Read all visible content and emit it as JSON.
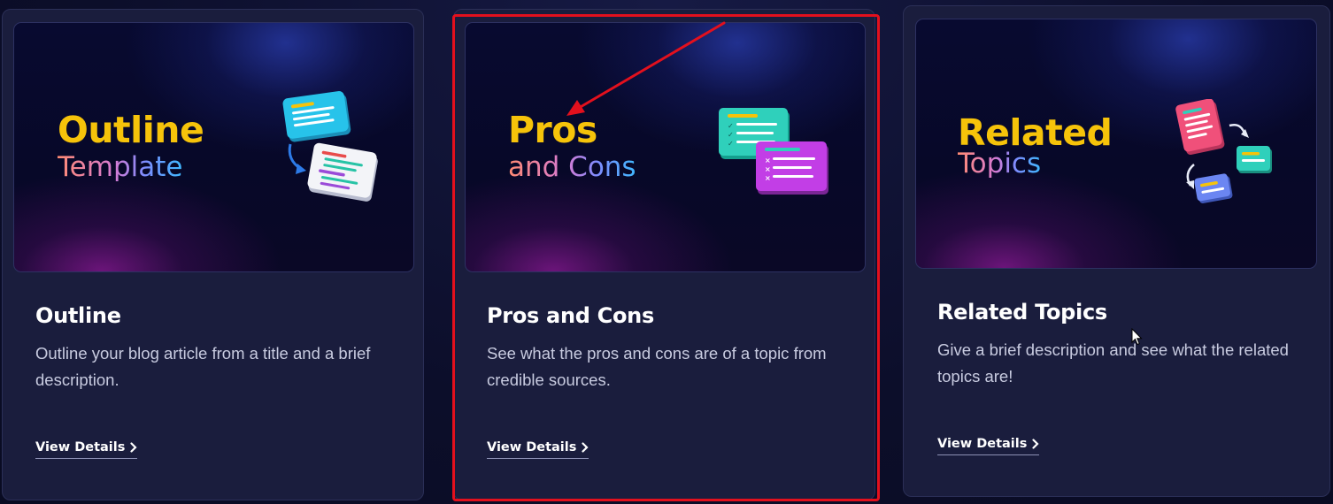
{
  "cards": [
    {
      "thumb_line1": "Outline",
      "thumb_line2": "Template",
      "title": "Outline",
      "description": "Outline your blog article from a title and a brief description.",
      "link_label": "View Details"
    },
    {
      "thumb_line1": "Pros",
      "thumb_line2": "and Cons",
      "title": "Pros and Cons",
      "description": "See what the pros and cons are of a topic from credible sources.",
      "link_label": "View Details"
    },
    {
      "thumb_line1": "Related",
      "thumb_line2": "Topics",
      "title": "Related Topics",
      "description": "Give a brief description and see what the related topics are!",
      "link_label": "View Details"
    }
  ],
  "annotation": {
    "highlight_color": "#e3101d",
    "arrow_color": "#e3101d"
  },
  "icons": {
    "link_icon": "chevron-right-icon",
    "cursor_icon": "mouse-pointer-icon"
  },
  "colors": {
    "background": "#0c0e2a",
    "card": "#1a1d3d",
    "accent_yellow": "#f6c30a"
  }
}
